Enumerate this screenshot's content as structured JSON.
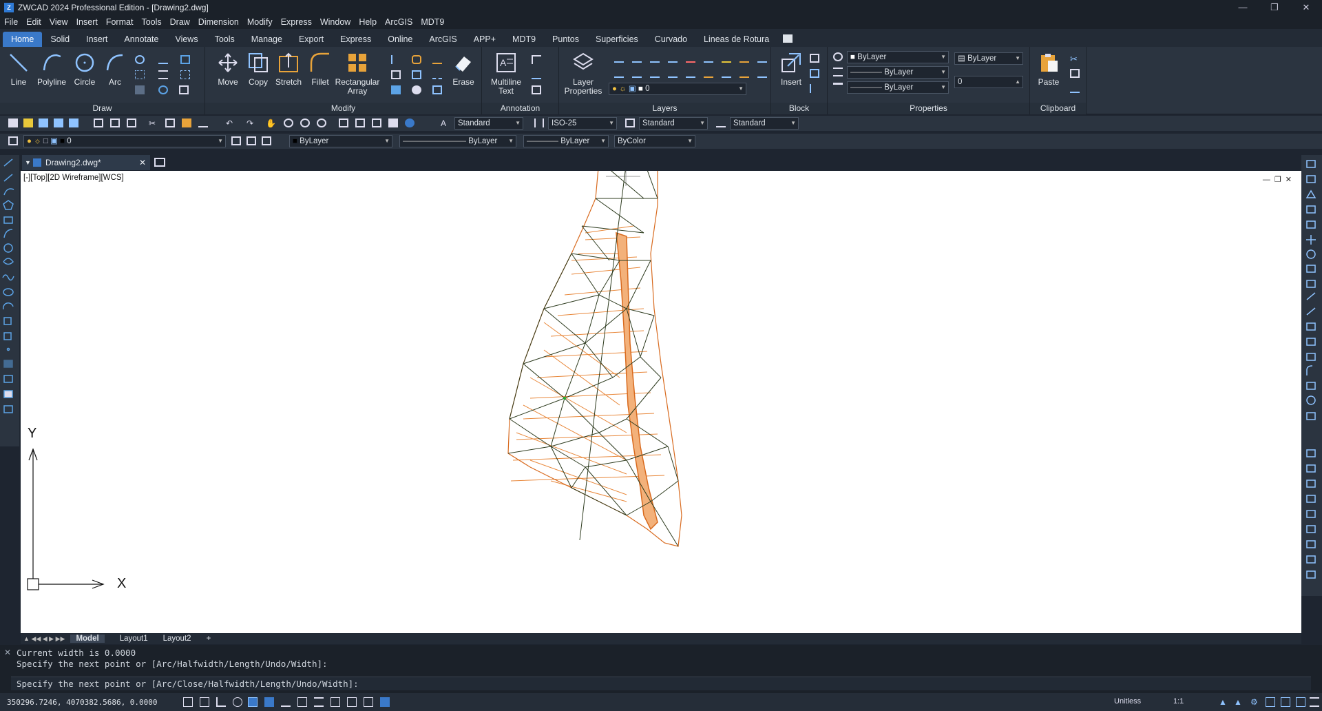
{
  "window": {
    "title": "ZWCAD 2024 Professional Edition - [Drawing2.dwg]",
    "app_icon": "Z",
    "controls": [
      "minimize-icon",
      "restore-icon",
      "close-icon"
    ]
  },
  "menu": [
    "File",
    "Edit",
    "View",
    "Insert",
    "Format",
    "Tools",
    "Draw",
    "Dimension",
    "Modify",
    "Express",
    "Window",
    "Help",
    "ArcGIS",
    "MDT9"
  ],
  "ribbon_tabs": [
    "Home",
    "Solid",
    "Insert",
    "Annotate",
    "Views",
    "Tools",
    "Manage",
    "Export",
    "Express",
    "Online",
    "ArcGIS",
    "APP+",
    "MDT9",
    "Puntos",
    "Superficies",
    "Curvado",
    "Lineas de Rotura"
  ],
  "active_ribbon_tab": "Home",
  "panels": {
    "draw": {
      "title": "Draw",
      "buttons": [
        "Line",
        "Polyline",
        "Circle",
        "Arc"
      ]
    },
    "modify": {
      "title": "Modify",
      "buttons": [
        "Move",
        "Copy",
        "Stretch",
        "Fillet",
        "Rectangular Array",
        "Erase"
      ]
    },
    "annotation": {
      "title": "Annotation",
      "buttons": [
        "Multiline Text"
      ]
    },
    "layers": {
      "title": "Layers",
      "buttons": [
        "Layer Properties"
      ],
      "current_layer": "0"
    },
    "block": {
      "title": "Block",
      "buttons": [
        "Insert"
      ]
    },
    "properties": {
      "title": "Properties",
      "color": "ByLayer",
      "linetype": "ByLayer",
      "lineweight": "ByLayer",
      "plotstyle": "ByLayer",
      "transparency": "0"
    },
    "clipboard": {
      "title": "Clipboard",
      "buttons": [
        "Paste"
      ]
    }
  },
  "toolbar_row1": {
    "text_style": "Standard",
    "dim_style": "ISO-25",
    "table_style": "Standard",
    "mleader_style": "Standard"
  },
  "toolbar_row2": {
    "layer": "0",
    "color": "ByLayer",
    "linetype": "ByLayer",
    "lineweight": "ByLayer",
    "plotstyle": "ByColor"
  },
  "document_tab": "Drawing2.dwg*",
  "viewport_label": "[-][Top][2D Wireframe][WCS]",
  "ucs": {
    "x_label": "X",
    "y_label": "Y"
  },
  "layout_tabs": [
    "Model",
    "Layout1",
    "Layout2",
    "+"
  ],
  "active_layout": "Model",
  "command_history": [
    "Current width is 0.0000",
    "Specify the next point or [Arc/Halfwidth/Length/Undo/Width]:"
  ],
  "command_prompt": "Specify the next point or [Arc/Close/Halfwidth/Length/Undo/Width]:",
  "status": {
    "coordinates": "350296.7246, 4070382.5686, 0.0000",
    "units": "Unitless",
    "scale": "1:1"
  },
  "colors": {
    "accent": "#3a79c9",
    "surface_orange": "#e8873a",
    "mesh_dark": "#2d3b1e",
    "canvas": "#ffffff"
  }
}
